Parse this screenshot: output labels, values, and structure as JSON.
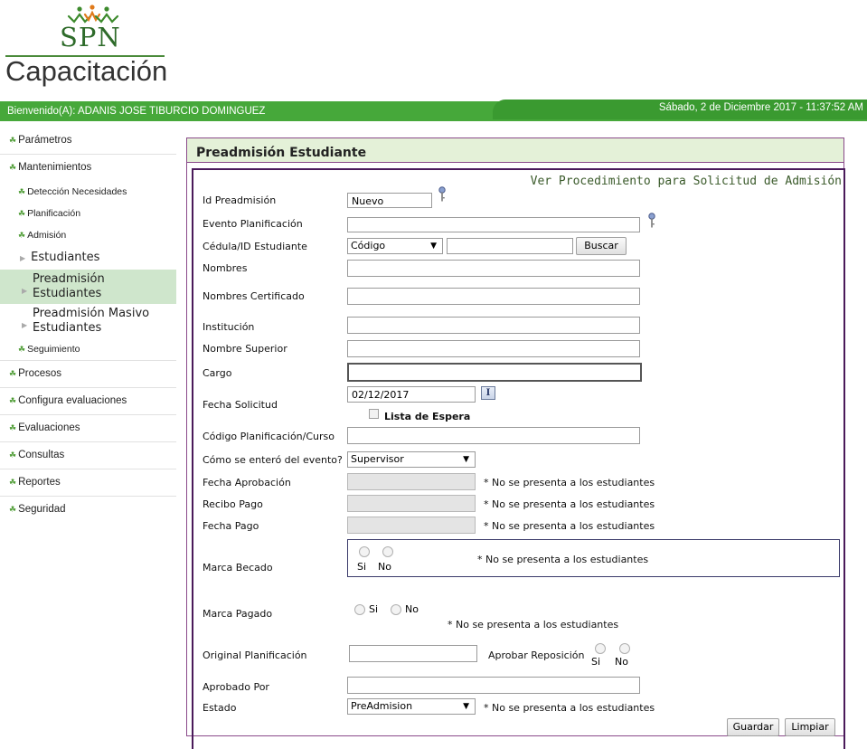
{
  "header": {
    "logo_text": "SPN",
    "subtitle": "Capacitación",
    "welcome": "Bienvenido(A): ADANIS JOSE TIBURCIO DOMINGUEZ",
    "datetime": "Sábado, 2 de Diciembre 2017 - 11:37:52 AM"
  },
  "sidebar": {
    "items": [
      {
        "label": "Parámetros"
      },
      {
        "label": "Mantenimientos"
      },
      {
        "label": "Detección Necesidades"
      },
      {
        "label": "Planificación"
      },
      {
        "label": "Admisión"
      },
      {
        "label": "Estudiantes"
      },
      {
        "label_line1": "Preadmisión",
        "label_line2": "Estudiantes"
      },
      {
        "label_line1": "Preadmisión Masivo",
        "label_line2": "Estudiantes"
      },
      {
        "label": "Seguimiento"
      },
      {
        "label": "Procesos"
      },
      {
        "label": "Configura evaluaciones"
      },
      {
        "label": "Evaluaciones"
      },
      {
        "label": "Consultas"
      },
      {
        "label": "Reportes"
      },
      {
        "label": "Seguridad"
      }
    ]
  },
  "form": {
    "title": "Preadmisión Estudiante",
    "procedure_link": "Ver Procedimiento para Solicitud de Admisión",
    "fields": {
      "id_preadmision": {
        "label": "Id Preadmisión",
        "value": "Nuevo"
      },
      "evento": {
        "label": "Evento Planificación",
        "value": ""
      },
      "cedula": {
        "label": "Cédula/ID Estudiante",
        "select_value": "Código",
        "value": "",
        "button": "Buscar"
      },
      "nombres": {
        "label": "Nombres",
        "value": ""
      },
      "nombres_cert": {
        "label": "Nombres Certificado",
        "value": ""
      },
      "institucion": {
        "label": "Institución",
        "value": ""
      },
      "nombre_superior": {
        "label": "Nombre Superior",
        "value": ""
      },
      "cargo": {
        "label": "Cargo",
        "value": ""
      },
      "fecha_solicitud": {
        "label": "Fecha Solicitud",
        "value": "02/12/2017"
      },
      "lista_espera": {
        "label": "Lista de Espera"
      },
      "codigo_plan": {
        "label": "Código Planificación/Curso",
        "value": ""
      },
      "como_entero": {
        "label": "Cómo se enteró del evento?",
        "value": "Supervisor"
      },
      "fecha_aprobacion": {
        "label": "Fecha Aprobación",
        "value": ""
      },
      "recibo_pago": {
        "label": "Recibo Pago",
        "value": ""
      },
      "fecha_pago": {
        "label": "Fecha Pago",
        "value": ""
      },
      "marca_becado": {
        "label": "Marca Becado",
        "opt_si": "Si",
        "opt_no": "No"
      },
      "marca_pagado": {
        "label": "Marca Pagado",
        "opt_si": "Si",
        "opt_no": "No"
      },
      "original_plan": {
        "label": "Original Planificación",
        "value": ""
      },
      "aprobar_reposicion": {
        "label": "Aprobar Reposición",
        "opt_si": "Si",
        "opt_no": "No"
      },
      "aprobado_por": {
        "label": "Aprobado Por",
        "value": ""
      },
      "estado": {
        "label": "Estado",
        "value": "PreAdmision"
      }
    },
    "note": "* No se presenta a los estudiantes",
    "buttons": {
      "save": "Guardar",
      "clear": "Limpiar"
    }
  },
  "colors": {
    "brand_green": "#46a83a",
    "panel_title_bg": "#e4f1d8",
    "active_item": "#cfe6cc"
  }
}
